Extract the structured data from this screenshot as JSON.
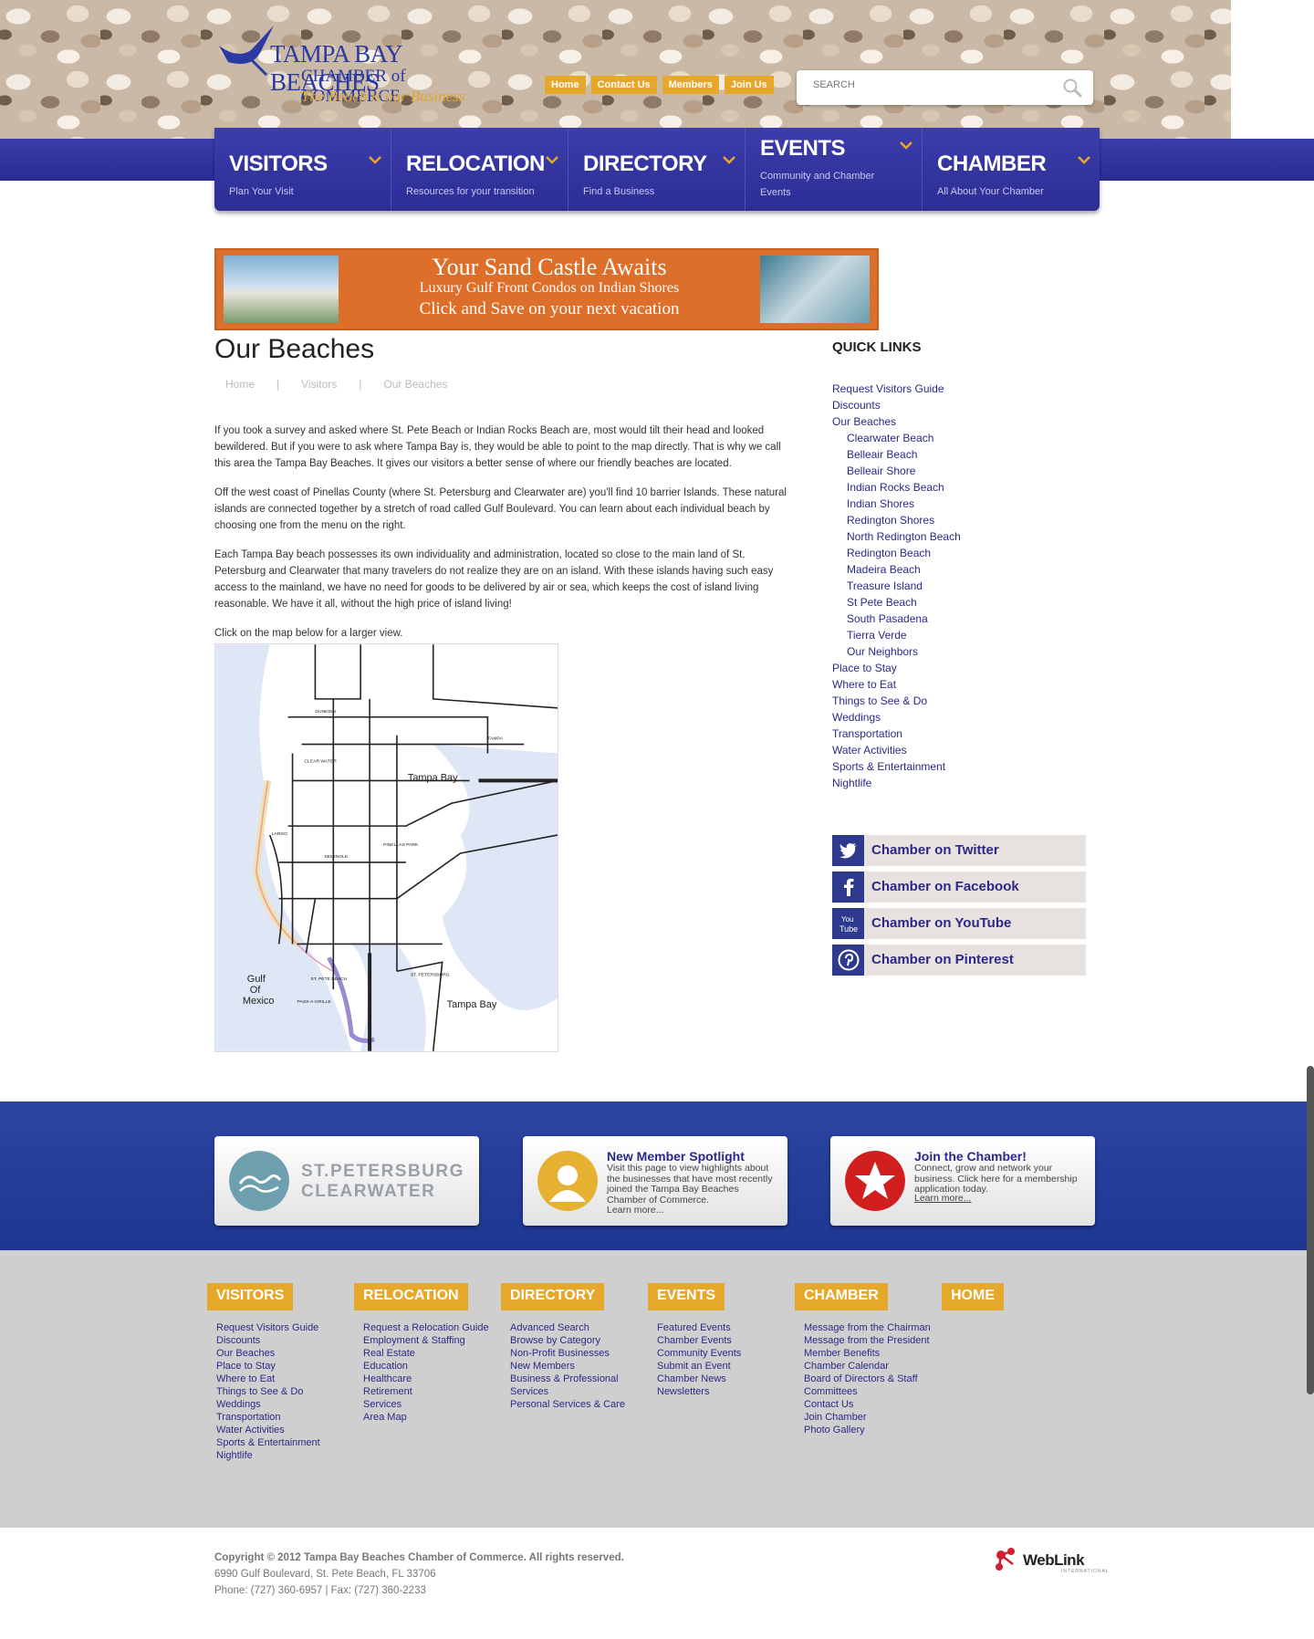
{
  "header": {
    "logo": {
      "line1": "TAMPA BAY BEACHES",
      "line2": "CHAMBER of COMMERCE",
      "tagline": "The Beach is our Business"
    },
    "top_nav": [
      "Home",
      "Contact Us",
      "Members",
      "Join Us"
    ],
    "search_placeholder": "SEARCH",
    "main_nav": [
      {
        "title": "VISITORS",
        "subtitle": "Plan Your Visit"
      },
      {
        "title": "RELOCATION",
        "subtitle": "Resources for your transition"
      },
      {
        "title": "DIRECTORY",
        "subtitle": "Find a Business"
      },
      {
        "title": "EVENTS",
        "subtitle": "Community and Chamber Events"
      },
      {
        "title": "CHAMBER",
        "subtitle": "All About Your Chamber"
      }
    ]
  },
  "banner": {
    "line1": "Your Sand Castle Awaits",
    "line2": "Luxury Gulf Front Condos on Indian Shores",
    "line3": "Click and Save on your next vacation"
  },
  "main": {
    "title": "Our Beaches",
    "breadcrumb": [
      "Home",
      "Visitors",
      "Our Beaches"
    ],
    "paragraphs": [
      "If you took a survey and asked where St. Pete Beach or Indian Rocks Beach are, most would tilt their head and looked bewildered. But if you were to ask where Tampa Bay is, they would be able to point to the map directly. That is why we call this area the Tampa Bay Beaches. It gives our visitors a better sense of where our friendly beaches are located.",
      "Off the west coast of Pinellas County (where St. Petersburg and Clearwater are) you'll find 10 barrier Islands. These natural islands are connected together by a stretch of road called Gulf Boulevard. You can learn about each individual beach by choosing one from the menu on the right.",
      "Each Tampa Bay beach possesses its own individuality and administration, located so close to the main land of St. Petersburg and Clearwater that many travelers do not realize they are on an island. With these islands having such easy access to the mainland, we have no need for goods to be delivered by air or sea, which keeps the cost of island living reasonable. We have it all, without the high price of island living!"
    ],
    "map_caption": "Click on the map below for a larger view.",
    "map_labels": {
      "tampa_bay_top": "Tampa Bay",
      "tampa_bay_bottom": "Tampa Bay",
      "gulf": [
        "Gulf",
        "Of",
        "Mexico"
      ],
      "clearwater": "CLEAR WATER",
      "largo": "LARGO",
      "seminole": "SEMINOLE",
      "pinellas_park": "PINELLAS PARK",
      "st_petersburg": "ST. PETERSBURG",
      "tampa": "TAMPA",
      "dunedin": "DUNEDIN",
      "st_pete_beach": "ST. PETE BEACH",
      "pass_a_grille": "PASS-A-GRILLE"
    }
  },
  "sidebar": {
    "title": "QUICK LINKS",
    "links": [
      {
        "label": "Request Visitors Guide",
        "sub": false
      },
      {
        "label": "Discounts",
        "sub": false
      },
      {
        "label": "Our Beaches",
        "sub": false
      },
      {
        "label": "Clearwater Beach",
        "sub": true
      },
      {
        "label": "Belleair Beach",
        "sub": true
      },
      {
        "label": "Belleair Shore",
        "sub": true
      },
      {
        "label": "Indian Rocks Beach",
        "sub": true
      },
      {
        "label": "Indian Shores",
        "sub": true
      },
      {
        "label": "Redington Shores",
        "sub": true
      },
      {
        "label": "North Redington Beach",
        "sub": true
      },
      {
        "label": "Redington Beach",
        "sub": true
      },
      {
        "label": "Madeira Beach",
        "sub": true
      },
      {
        "label": "Treasure Island",
        "sub": true
      },
      {
        "label": "St Pete Beach",
        "sub": true
      },
      {
        "label": "South Pasadena",
        "sub": true
      },
      {
        "label": "Tierra Verde",
        "sub": true
      },
      {
        "label": "Our Neighbors",
        "sub": true
      },
      {
        "label": "Place to Stay",
        "sub": false
      },
      {
        "label": "Where to Eat",
        "sub": false
      },
      {
        "label": "Things to See & Do",
        "sub": false
      },
      {
        "label": "Weddings",
        "sub": false
      },
      {
        "label": "Transportation",
        "sub": false
      },
      {
        "label": "Water Activities",
        "sub": false
      },
      {
        "label": "Sports & Entertainment",
        "sub": false
      },
      {
        "label": "Nightlife",
        "sub": false
      }
    ],
    "social": [
      {
        "label": "Chamber on Twitter",
        "icon": "twitter-icon"
      },
      {
        "label": "Chamber on Facebook",
        "icon": "facebook-icon"
      },
      {
        "label": "Chamber on YouTube",
        "icon": "youtube-icon"
      },
      {
        "label": "Chamber on Pinterest",
        "icon": "pinterest-icon"
      }
    ]
  },
  "promo": {
    "box1": {
      "line1": "ST.PETERSBURG",
      "line2": "CLEARWATER"
    },
    "box2": {
      "title": "New Member Spotlight",
      "desc": "Visit this page to view highlights about the businesses that have most recently joined the Tampa Bay Beaches Chamber of Commerce.",
      "more": "Learn more..."
    },
    "box3": {
      "title": "Join the Chamber!",
      "desc": "Connect, grow and network your business. Click here for a membership application today.",
      "more": "Learn more..."
    }
  },
  "footer_nav": [
    {
      "heading": "VISITORS",
      "links": [
        "Request Visitors Guide",
        "Discounts",
        "Our Beaches",
        "Place to Stay",
        "Where to Eat",
        "Things to See & Do",
        "Weddings",
        "Transportation",
        "Water Activities",
        "Sports & Entertainment",
        "Nightlife"
      ]
    },
    {
      "heading": "RELOCATION",
      "links": [
        "Request a Relocation Guide",
        "Employment & Staffing",
        "Real Estate",
        "Education",
        "Healthcare",
        "Retirement",
        "Services",
        "Area Map"
      ]
    },
    {
      "heading": "DIRECTORY",
      "links": [
        "Advanced Search",
        "Browse by Category",
        "Non-Profit Businesses",
        "New Members",
        "Business & Professional Services",
        "Personal Services & Care"
      ]
    },
    {
      "heading": "EVENTS",
      "links": [
        "Featured Events",
        "Chamber Events",
        "Community Events",
        "Submit an Event",
        "Chamber News",
        "Newsletters"
      ]
    },
    {
      "heading": "CHAMBER",
      "links": [
        "Message from the Chairman",
        "Message from the President",
        "Member Benefits",
        "Chamber Calendar",
        "Board of Directors & Staff",
        "Committees",
        "Contact Us",
        "Join Chamber",
        "Photo Gallery"
      ]
    },
    {
      "heading": "HOME",
      "links": []
    }
  ],
  "bottom": {
    "copyright": "Copyright © 2012 Tampa Bay Beaches Chamber of Commerce.  All rights reserved.",
    "address": "6990 Gulf Boulevard, St. Pete Beach, FL 33706",
    "phone": "Phone: (727) 360-6957 | Fax: (727) 360-2233",
    "weblink": "WebLink",
    "weblink_sub": "INTERNATIONAL"
  }
}
